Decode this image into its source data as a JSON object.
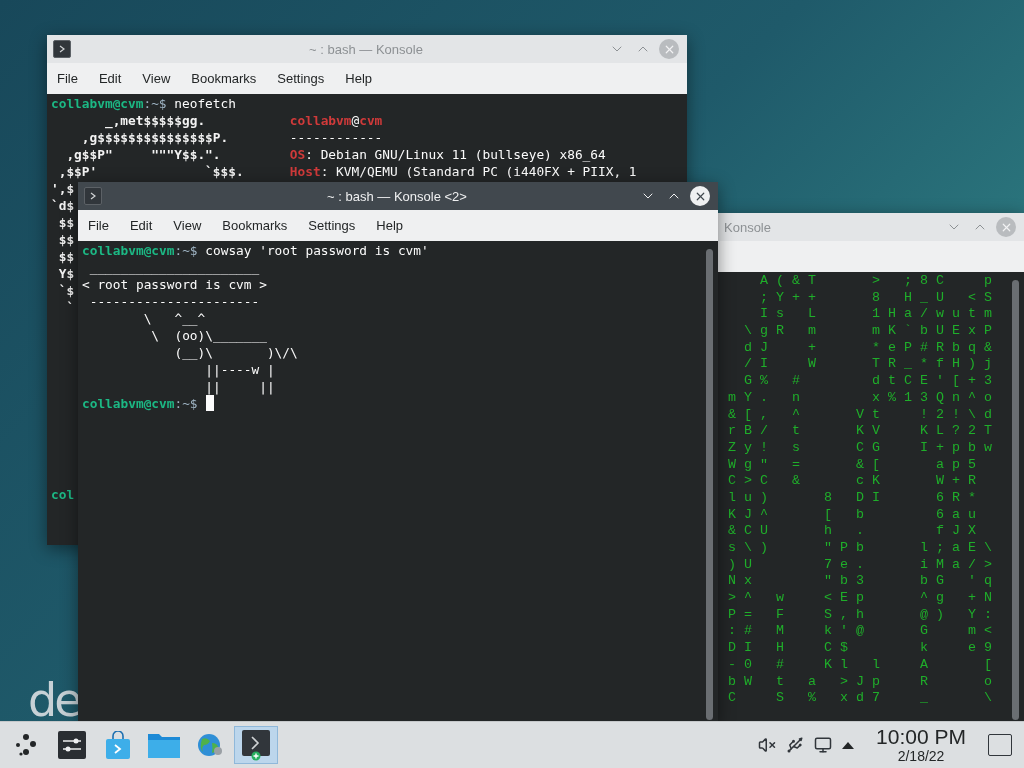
{
  "desktop": {
    "logo_text": "de"
  },
  "windows": [
    {
      "kind": "neofetch",
      "title": "~ : bash — Konsole",
      "active": false,
      "menu": [
        "File",
        "Edit",
        "View",
        "Bookmarks",
        "Settings",
        "Help"
      ],
      "lines": [
        {
          "kind": "prompt",
          "user": "collabvm@cvm",
          "path": ":~$",
          "command": "neofetch"
        },
        {
          "kind": "fetch",
          "art": "       _,met$$$$$gg.",
          "info": [
            {
              "kind": "accent",
              "text": "collabvm"
            },
            {
              "kind": "plain",
              "text": "@"
            },
            {
              "kind": "accent",
              "text": "cvm"
            }
          ]
        },
        {
          "kind": "fetch",
          "art": "    ,g$$$$$$$$$$$$$$$P.",
          "info": [
            {
              "kind": "plain",
              "text": "------------"
            }
          ]
        },
        {
          "kind": "fetch",
          "art": "  ,g$$P\"     \"\"\"Y$$.\".",
          "info": [
            {
              "kind": "accent",
              "text": "OS"
            },
            {
              "kind": "plain",
              "text": ": Debian GNU/Linux 11 (bullseye) x86_64"
            }
          ]
        },
        {
          "kind": "fetch",
          "art": " ,$$P'              `$$$.",
          "info": [
            {
              "kind": "accent",
              "text": "Host"
            },
            {
              "kind": "plain",
              "text": ": KVM/QEMU (Standard PC (i440FX + PIIX, 1"
            }
          ]
        },
        {
          "kind": "fetch",
          "art": "',$"
        },
        {
          "kind": "fetch",
          "art": "`d$"
        },
        {
          "kind": "fetch",
          "art": " $$"
        },
        {
          "kind": "fetch",
          "art": " $$"
        },
        {
          "kind": "fetch",
          "art": " $$"
        },
        {
          "kind": "fetch",
          "art": " Y$"
        },
        {
          "kind": "fetch",
          "art": " `$"
        },
        {
          "kind": "fetch",
          "art": "  `"
        },
        {
          "kind": "blank"
        },
        {
          "kind": "blank"
        },
        {
          "kind": "blank"
        },
        {
          "kind": "blank"
        },
        {
          "kind": "blank"
        },
        {
          "kind": "blank"
        },
        {
          "kind": "blank"
        },
        {
          "kind": "blank"
        },
        {
          "kind": "blank"
        },
        {
          "kind": "blank"
        },
        {
          "kind": "prompt",
          "user": "col"
        }
      ]
    },
    {
      "kind": "cowsay",
      "title": "~ : bash — Konsole <2>",
      "active": true,
      "menu": [
        "File",
        "Edit",
        "View",
        "Bookmarks",
        "Settings",
        "Help"
      ],
      "lines": [
        {
          "kind": "prompt",
          "user": "collabvm@cvm",
          "path": ":~$",
          "command": "cowsay 'root password is cvm'"
        },
        {
          "kind": "output",
          "text": " ______________________"
        },
        {
          "kind": "output",
          "text": "< root password is cvm >"
        },
        {
          "kind": "output",
          "text": " ----------------------"
        },
        {
          "kind": "output",
          "text": "        \\   ^__^"
        },
        {
          "kind": "output",
          "text": "         \\  (oo)\\_______"
        },
        {
          "kind": "output",
          "text": "            (__)\\       )\\/\\"
        },
        {
          "kind": "output",
          "text": "                ||----w |"
        },
        {
          "kind": "output",
          "text": "                ||     ||"
        },
        {
          "kind": "prompt",
          "user": "collabvm@cvm",
          "path": ":~$",
          "cursor": true
        }
      ]
    },
    {
      "kind": "matrix",
      "title": "Konsole",
      "active": false,
      "lines": [
        {
          "kind": "rain",
          "text": "  A(&T   > ;8C  p"
        },
        {
          "kind": "rain",
          "text": "  ;Y++   8 H_U <S"
        },
        {
          "kind": "rain",
          "text": "  Is L   1Ha/wutm"
        },
        {
          "kind": "rain",
          "text": " \\gR m   mK`bUExP"
        },
        {
          "kind": "rain",
          "text": " dJ  +   *eP#Rbq&"
        },
        {
          "kind": "rain",
          "text": " /I  W   TR_*fH)j"
        },
        {
          "kind": "rain",
          "text": " G% #    dtCE'[+3"
        },
        {
          "kind": "rain",
          "text": "mY. n    x%13Qn^o"
        },
        {
          "kind": "rain",
          "text": "&[, ^   Vt  !2!\\d"
        },
        {
          "kind": "rain",
          "text": "rB/ t   KV  KL?2T"
        },
        {
          "kind": "rain",
          "text": "Zy! s   CG  I+pbw"
        },
        {
          "kind": "rain",
          "text": "Wg\" =   &[   ap5"
        },
        {
          "kind": "rain",
          "text": "C>C &   cK   W+R"
        },
        {
          "kind": "rain",
          "text": "lu)   8 DI   6R*"
        },
        {
          "kind": "rain",
          "text": "KJ^   [ b    6au"
        },
        {
          "kind": "rain",
          "text": "&CU   h .    fJX"
        },
        {
          "kind": "rain",
          "text": "s\\)   \"Pb   l;aE\\"
        },
        {
          "kind": "rain",
          "text": ")U    7e.   iMa/>"
        },
        {
          "kind": "rain",
          "text": "Nx    \"b3   bG 'q"
        },
        {
          "kind": "rain",
          "text": ">^ w  <Ep   ^g +N"
        },
        {
          "kind": "rain",
          "text": "P= F  S,h   @) Y:"
        },
        {
          "kind": "rain",
          "text": ":# M  k'@   G  m<"
        },
        {
          "kind": "rain",
          "text": "DI H  C$    k  e9"
        },
        {
          "kind": "rain",
          "text": "-0 #  Kl l  A   ["
        },
        {
          "kind": "rain",
          "text": "bW t a >Jp  R   o"
        },
        {
          "kind": "rain",
          "text": "C  S % xd7  _   \\"
        }
      ]
    }
  ],
  "taskbar": {
    "tasks": [
      {
        "kind": "settings",
        "selected": false
      },
      {
        "kind": "store",
        "selected": false
      },
      {
        "kind": "files",
        "selected": false
      },
      {
        "kind": "browser",
        "selected": false
      },
      {
        "kind": "terminal",
        "selected": true
      }
    ],
    "clock": {
      "time": "10:00 PM",
      "date": "2/18/22"
    }
  }
}
